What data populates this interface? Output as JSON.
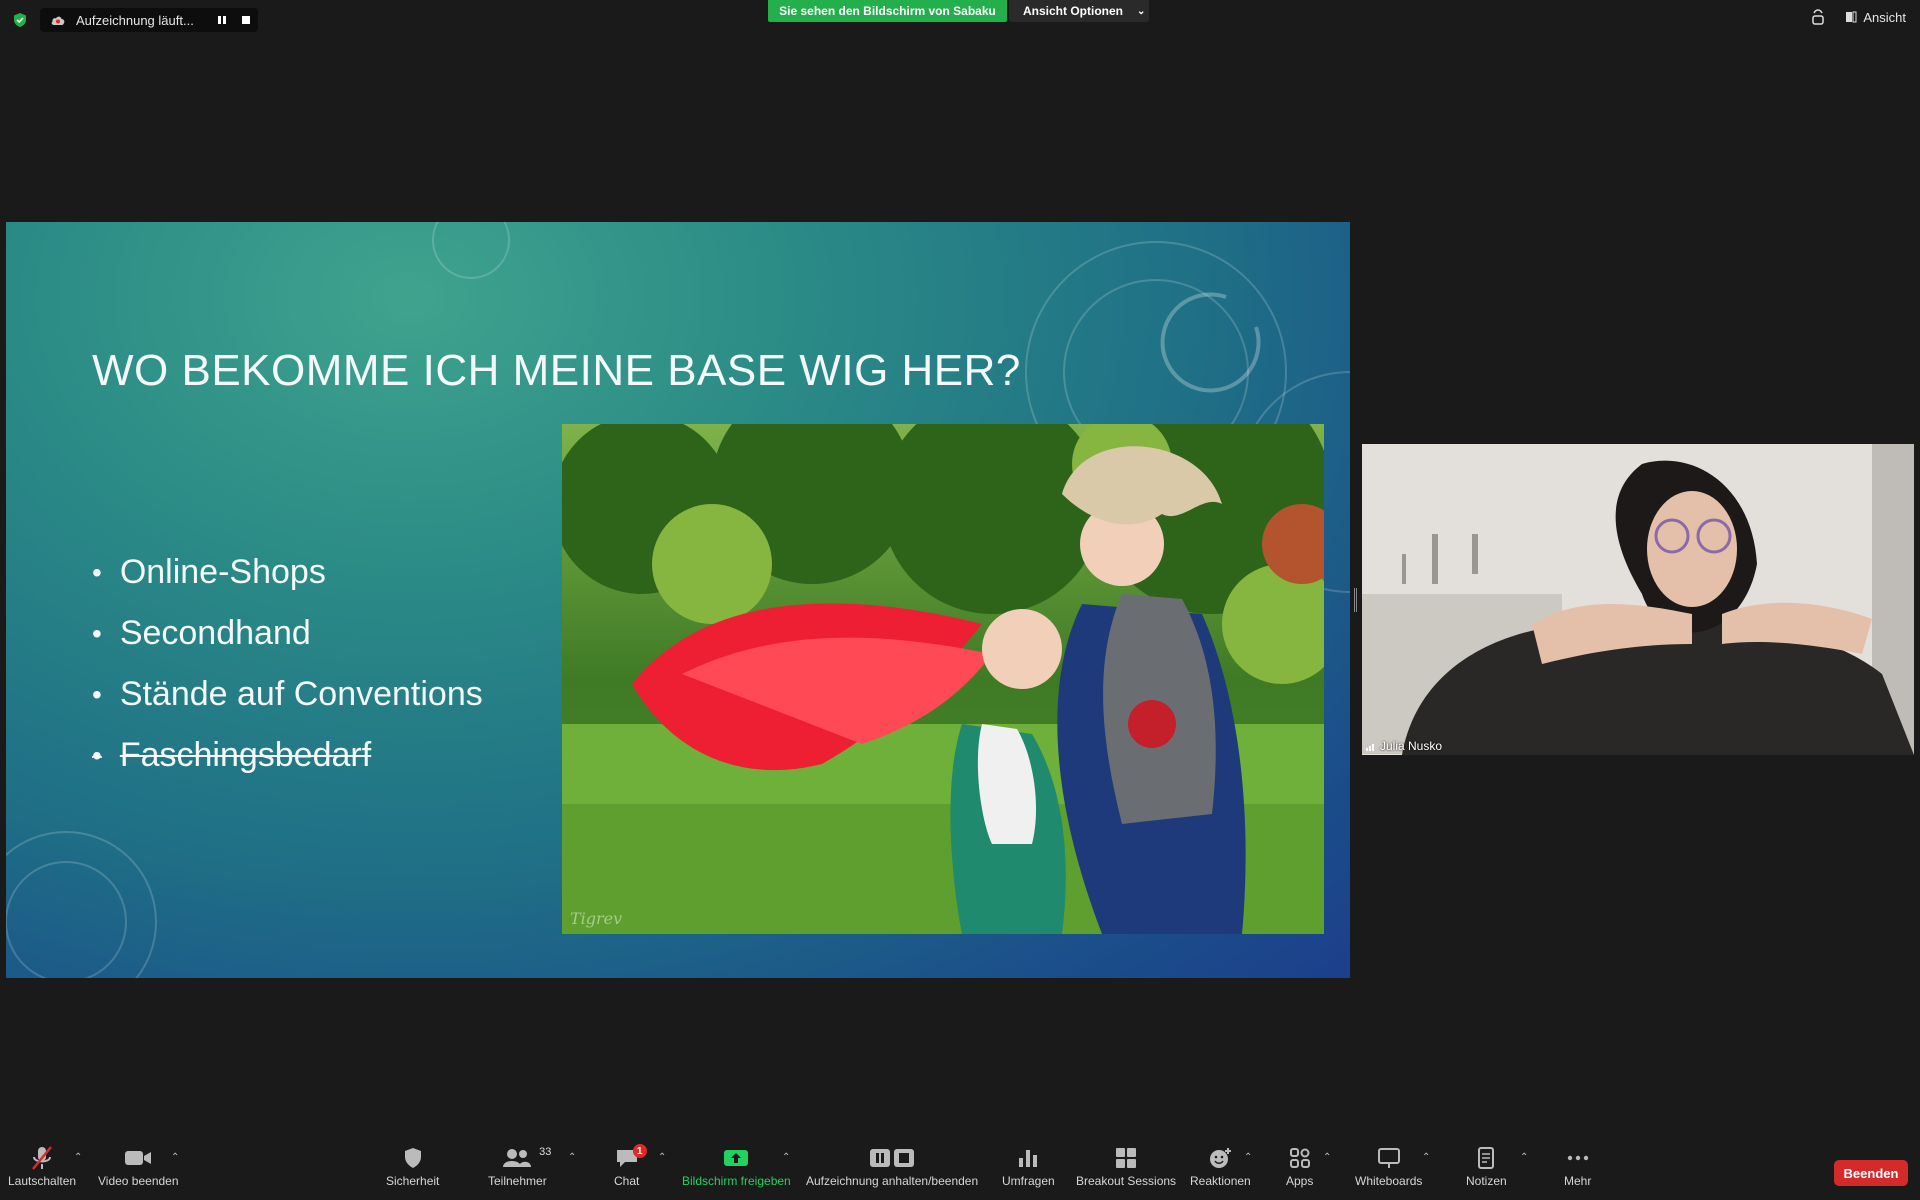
{
  "recording": {
    "label": "Aufzeichnung läuft..."
  },
  "share_banner": "Sie sehen den Bildschirm von Sabaku",
  "view_options": "Ansicht Optionen",
  "view_button": "Ansicht",
  "colors": {
    "share_green": "#23b04c",
    "end_red": "#d42a2a",
    "background": "#1a1a1a"
  },
  "slide": {
    "title": "WO BEKOMME ICH MEINE BASE WIG HER?",
    "bullets": [
      "Online-Shops",
      "Secondhand",
      "Stände auf Conventions",
      "Faschingsbedarf"
    ],
    "struck_bullet_index": 3,
    "photo_credit": "Tigrev"
  },
  "participant": {
    "name": "Julia Nusko"
  },
  "toolbar": {
    "mute": "Lautschalten",
    "video": "Video beenden",
    "security": "Sicherheit",
    "participants": "Teilnehmer",
    "participants_count": "33",
    "chat": "Chat",
    "chat_badge": "1",
    "share": "Bildschirm freigeben",
    "recording": "Aufzeichnung anhalten/beenden",
    "polls": "Umfragen",
    "breakout": "Breakout Sessions",
    "reactions": "Reaktionen",
    "apps": "Apps",
    "whiteboards": "Whiteboards",
    "notes": "Notizen",
    "more": "Mehr",
    "end": "Beenden"
  }
}
